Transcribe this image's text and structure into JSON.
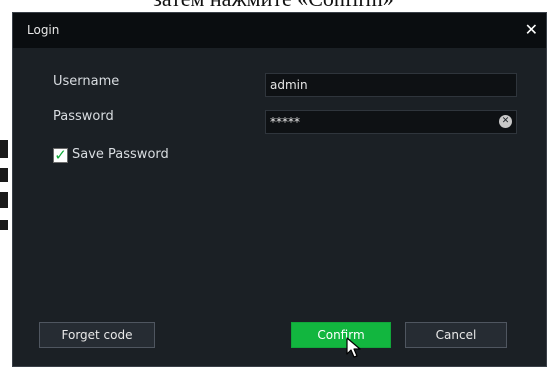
{
  "caption": {
    "text": "затем нажмите «Confirm»"
  },
  "dialog": {
    "title": "Login",
    "close_glyph": "✕"
  },
  "username": {
    "label": "Username",
    "value": "admin"
  },
  "password": {
    "label": "Password",
    "value": "*****",
    "clear_glyph": "✕"
  },
  "save_password": {
    "label": "Save Password",
    "checked": true,
    "check_glyph": "✓"
  },
  "buttons": {
    "forget_code": "Forget code",
    "confirm": "Confirm",
    "cancel": "Cancel"
  },
  "icons": {
    "close": "close-icon",
    "clear": "clear-input-icon",
    "check": "check-icon",
    "cursor": "mouse-cursor-icon"
  },
  "colors": {
    "dialog_background": "#1b2025",
    "titlebar": "#0a0d10",
    "confirm_button": "#12b63f",
    "check_mark": "#11a93a"
  }
}
